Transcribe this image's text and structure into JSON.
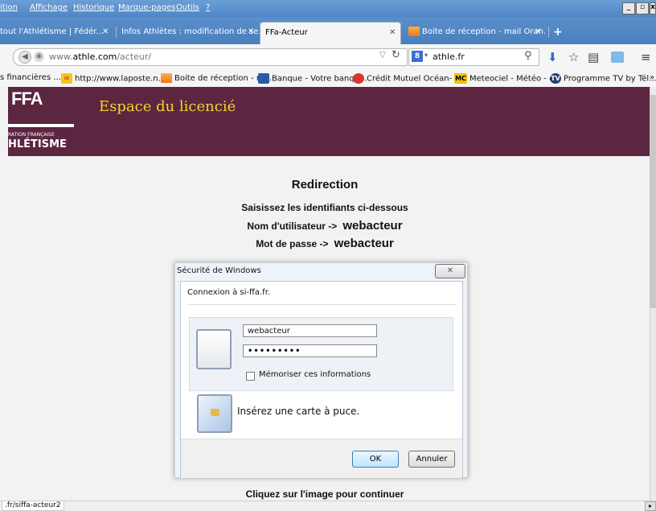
{
  "menu": {
    "items": [
      "ition",
      "Affichage",
      "Historique",
      "Marque-pages",
      "Outils",
      "?"
    ]
  },
  "tabs": [
    {
      "label": "tout l'Athlétisme | Fédér...",
      "close": "✕"
    },
    {
      "label": "Infos Athlètes : modification de se...",
      "close": "✕"
    },
    {
      "label": "FFa-Acteur",
      "close": "✕"
    },
    {
      "label": "Boite de réception - mail Oran...",
      "close": "✕"
    }
  ],
  "new_tab": "+",
  "navbar": {
    "url_prefix": "www.",
    "url_domain": "athle.com",
    "url_path": "/acteur/",
    "search_value": "athle.fr",
    "search_engine_badge": "8"
  },
  "bookmarks": [
    {
      "label": "s financières ...",
      "icon": "none"
    },
    {
      "label": "http://www.laposte.n...",
      "icon": "laposte-icon"
    },
    {
      "label": "Boite de réception - m...",
      "icon": "orange-icon"
    },
    {
      "label": "Banque - Votre banqu...",
      "icon": "bank-icon"
    },
    {
      "label": "Crédit Mutuel Océan- ...",
      "icon": "credit-mutuel-icon"
    },
    {
      "label": "Meteociel - Météo - o...",
      "icon": "mc-icon",
      "badge": "MC"
    },
    {
      "label": "Programme TV by Tél...",
      "icon": "tv-icon",
      "badge": "TV"
    }
  ],
  "bookmarks_more": "»",
  "banner": {
    "title": "Espace du licencié",
    "logo_org_line": "RATION FRANÇAISE",
    "logo_name": "HLÉTISME",
    "logo_abbr": "FFA"
  },
  "page": {
    "heading": "Redirection",
    "instructions": "Saisissez les identifiants ci-dessous",
    "user_label": "Nom d'utilisateur ->",
    "user_value": "webacteur",
    "pass_label": "Mot de passe ->",
    "pass_value": "webacteur",
    "footer_text": "Cliquez sur l'image pour continuer"
  },
  "dialog": {
    "title": "Sécurité de Windows",
    "close": "✕",
    "subtitle": "Connexion à si-ffa.fr.",
    "username": "webacteur",
    "password": "•••••••••",
    "remember_label": "Mémoriser ces informations",
    "smartcard_label": "Insérez une carte à puce.",
    "ok_label": "OK",
    "cancel_label": "Annuler"
  },
  "status": {
    "url": ".fr/siffa-acteur2"
  },
  "colors": {
    "banner_bg": "#5c2540",
    "banner_title": "#f3d42e",
    "titlebar": "#4f86c6"
  }
}
